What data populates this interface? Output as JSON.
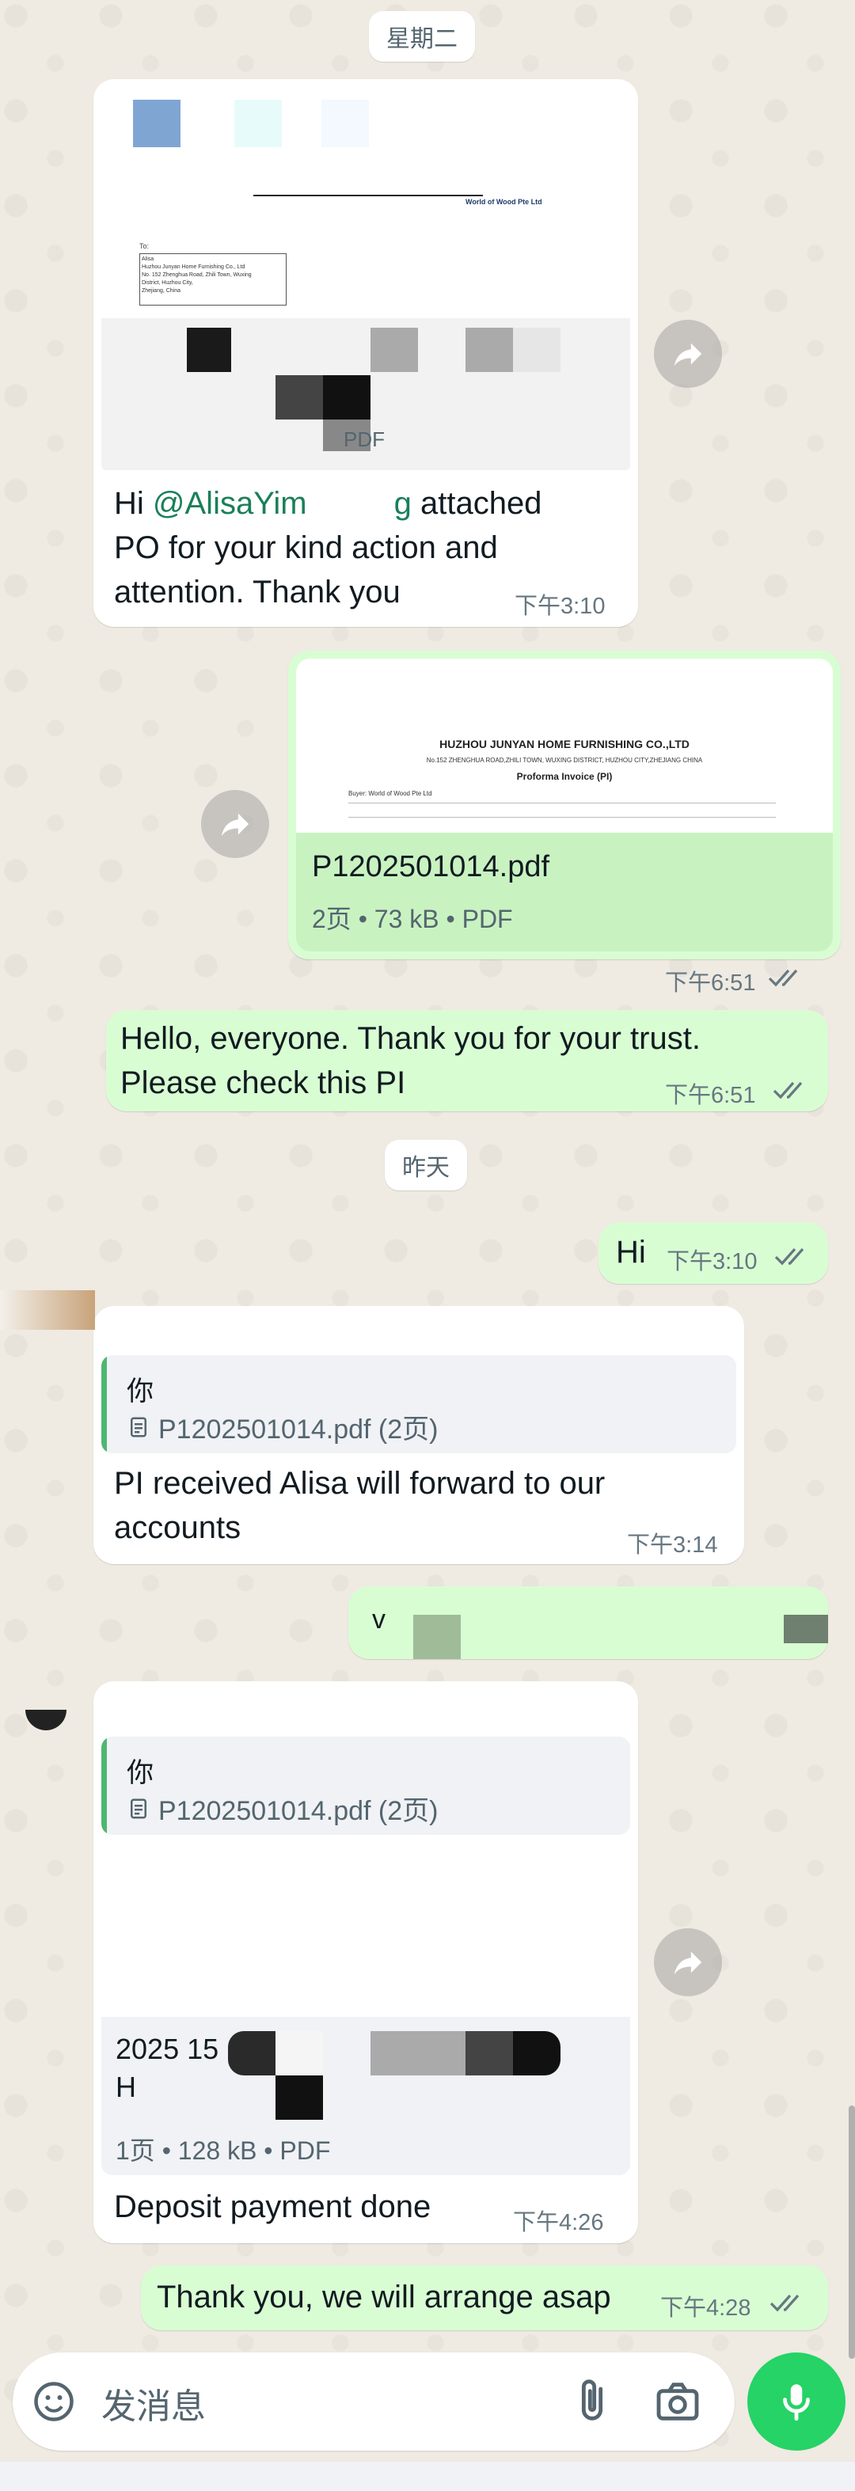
{
  "dates": {
    "tuesday": "星期二",
    "yesterday": "昨天"
  },
  "messages": {
    "m1": {
      "text_pre": "Hi ",
      "mention": "@AlisaYim",
      "trail_g": "g",
      "text_after": " attached",
      "line2": "PO for your kind action and",
      "line3": "attention. Thank you",
      "time": "下午3:10",
      "doc_to": "To:",
      "doc_addr1": "Alisa",
      "doc_addr2": "Huzhou Junyan Home Furnishing Co., Ltd",
      "doc_addr3": "No. 152 Zhenghua Road, Zhili Town, Wuxing",
      "doc_addr4": "District, Huzhou City,",
      "doc_addr5": "Zhejiang, China",
      "doc_head": "World of Wood Pte Ltd",
      "doc_pdf": "PDF"
    },
    "m2": {
      "company": "HUZHOU JUNYAN HOME FURNISHING CO.,LTD",
      "address": "No.152 ZHENGHUA ROAD,ZHILI TOWN, WUXING DISTRICT, HUZHOU CITY,ZHEJIANG CHINA",
      "doc_title": "Proforma Invoice (PI)",
      "buyer": "Buyer: World of Wood Pte Ltd",
      "filename": "P1202501014.pdf",
      "meta": "2页 • 73 kB • PDF",
      "time": "下午6:51"
    },
    "m3": {
      "line1": "Hello, everyone. Thank you for your trust.",
      "line2": "Please check this PI",
      "time": "下午6:51"
    },
    "m4": {
      "text": "Hi",
      "time": "下午3:10"
    },
    "m5": {
      "quote_author": "你",
      "quote_doc": "P1202501014.pdf (2页)",
      "line1": "PI received Alisa will forward to our",
      "line2": "accounts",
      "time": "下午3:14"
    },
    "m6": {
      "partial": "v"
    },
    "m7": {
      "quote_author": "你",
      "quote_doc": "P1202501014.pdf (2页)",
      "doc_line1": "2025 15",
      "doc_line2": "H",
      "meta": "1页 • 128 kB • PDF",
      "text": "Deposit payment done",
      "time": "下午4:26"
    },
    "m8": {
      "text": "Thank you, we will arrange asap",
      "time": "下午4:28"
    }
  },
  "input": {
    "placeholder": "发消息"
  },
  "colors": {
    "accent": "#25d366",
    "bubble_out": "#d9fdd3",
    "tick_read": "#53bdeb",
    "quote_bar": "#4fb672"
  },
  "icons": [
    "sticker-icon",
    "attachment-icon",
    "camera-icon",
    "mic-icon",
    "forward-icon",
    "document-icon",
    "double-check-icon"
  ]
}
